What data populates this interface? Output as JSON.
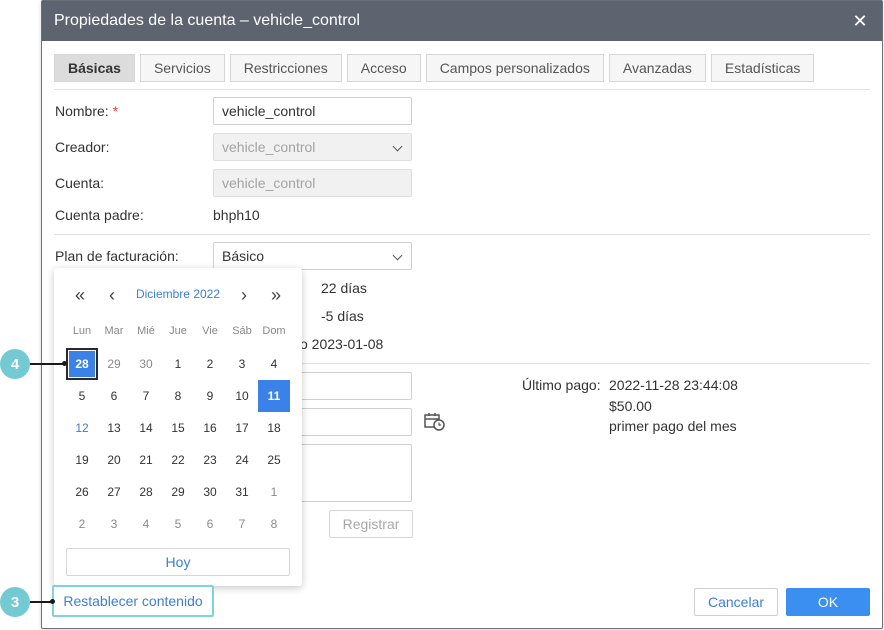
{
  "dialog": {
    "title": "Propiedades de la cuenta – vehicle_control",
    "close": "✕"
  },
  "tabs": [
    {
      "label": "Básicas",
      "active": true
    },
    {
      "label": "Servicios"
    },
    {
      "label": "Restricciones"
    },
    {
      "label": "Acceso"
    },
    {
      "label": "Campos personalizados"
    },
    {
      "label": "Avanzadas"
    },
    {
      "label": "Estadísticas"
    }
  ],
  "form": {
    "name_label": "Nombre:",
    "name_required": "*",
    "name_value": "vehicle_control",
    "creator_label": "Creador:",
    "creator_value": "vehicle_control",
    "account_label": "Cuenta:",
    "account_value": "vehicle_control",
    "parent_label": "Cuenta padre:",
    "parent_value": "bhph10",
    "plan_label": "Plan de facturación:",
    "plan_value": "Básico",
    "days_1": "22 días",
    "days_2": "-5 días",
    "date_partial": "o 2023-01-08",
    "register_button": "Registrar"
  },
  "last_payment": {
    "label": "Último pago:",
    "datetime": "2022-11-28 23:44:08",
    "amount": "$50.00",
    "note": "primer pago del mes"
  },
  "calendar": {
    "month": "Diciembre 2022",
    "nav_prev_year": "«",
    "nav_prev": "‹",
    "nav_next": "›",
    "nav_next_year": "»",
    "weekdays": [
      "Lun",
      "Mar",
      "Mié",
      "Jue",
      "Vie",
      "Sáb",
      "Dom"
    ],
    "weeks": [
      [
        "28",
        "29",
        "30",
        "1",
        "2",
        "3",
        "4"
      ],
      [
        "5",
        "6",
        "7",
        "8",
        "9",
        "10",
        "11"
      ],
      [
        "12",
        "13",
        "14",
        "15",
        "16",
        "17",
        "18"
      ],
      [
        "19",
        "20",
        "21",
        "22",
        "23",
        "24",
        "25"
      ],
      [
        "26",
        "27",
        "28",
        "29",
        "30",
        "31",
        "1"
      ],
      [
        "2",
        "3",
        "4",
        "5",
        "6",
        "7",
        "8"
      ]
    ],
    "selected_day": "28",
    "highlighted_day": "11",
    "today_day": "12",
    "today_button": "Hoy"
  },
  "footer": {
    "reset_button": "Restablecer contenido",
    "cancel_button": "Cancelar",
    "ok_button": "OK"
  },
  "callouts": [
    "4",
    "3"
  ],
  "colors": {
    "titlebar": "#5d6470",
    "accent": "#3b7fd6",
    "primary_button": "#3b8ff0",
    "callout": "#74cad2"
  }
}
